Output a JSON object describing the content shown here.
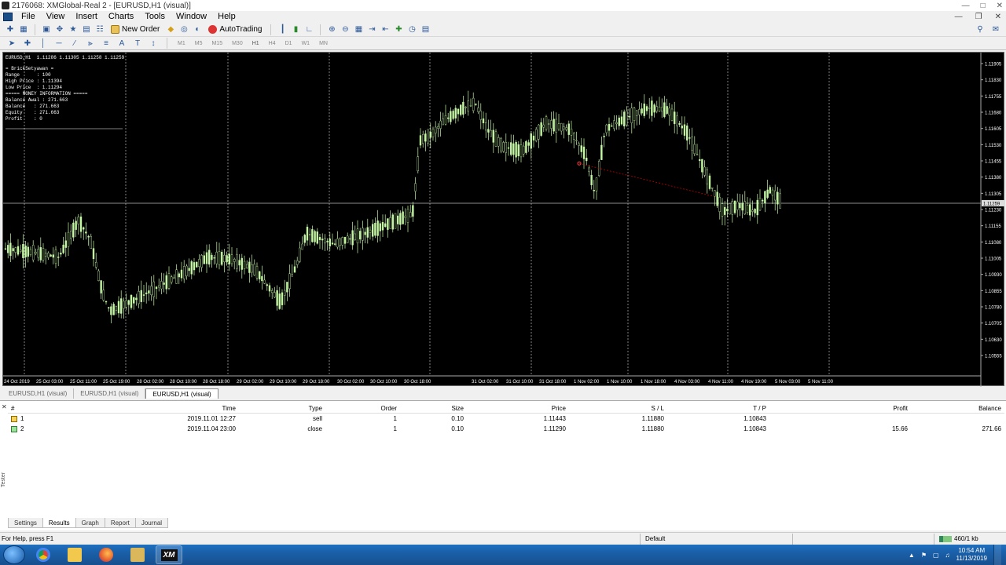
{
  "window": {
    "title": "2176068: XMGlobal-Real 2 - [EURUSD,H1 (visual)]"
  },
  "menu": {
    "items": [
      "File",
      "View",
      "Insert",
      "Charts",
      "Tools",
      "Window",
      "Help"
    ]
  },
  "toolbar": {
    "new_order_label": "New Order",
    "autotrading_label": "AutoTrading"
  },
  "toolbar2": {
    "timeframes": [
      "M1",
      "M5",
      "M15",
      "M30",
      "H1",
      "H4",
      "D1",
      "W1",
      "MN"
    ]
  },
  "chart": {
    "info_header": "EURUSD,H1  1.11286 1.11305 1.11258 1.11259",
    "info_lines": [
      "= BrickSetyawan =",
      "Range      : 100",
      "High Price : 1.11394",
      "Low Price  : 1.11294",
      "===== MONEY INFORMATION =====",
      "Balance Awal : 271.663",
      "Balance   : 271.663",
      "Equity    : 271.663",
      "Profit    : 0"
    ],
    "price_labels": [
      "1.11905",
      "1.11830",
      "1.11755",
      "1.11680",
      "1.11605",
      "1.11530",
      "1.11455",
      "1.11380",
      "1.11305",
      "1.11230",
      "1.11155",
      "1.11080",
      "1.11005",
      "1.10930",
      "1.10855",
      "1.10780",
      "1.10705",
      "1.10630",
      "1.10555"
    ],
    "current_price_label": "1.11259",
    "time_labels": [
      "24 Oct 2019",
      "25 Oct 03:00",
      "25 Oct 11:00",
      "25 Oct 19:00",
      "28 Oct 02:00",
      "28 Oct 10:00",
      "28 Oct 18:00",
      "29 Oct 02:00",
      "29 Oct 10:00",
      "29 Oct 18:00",
      "30 Oct 02:00",
      "30 Oct 10:00",
      "30 Oct 18:00",
      "31 Oct 02:00",
      "31 Oct 10:00",
      "31 Oct 18:00",
      "1 Nov 02:00",
      "1 Nov 10:00",
      "1 Nov 18:00",
      "4 Nov 03:00",
      "4 Nov 11:00",
      "4 Nov 19:00",
      "5 Nov 03:00",
      "5 Nov 11:00"
    ],
    "colors": {
      "background": "#000000",
      "candles": "#c6f7a6",
      "labels": "#2ec4c4",
      "grid": "#ffffff",
      "trade_line": "#c00000"
    }
  },
  "chart_tabs": [
    "EURUSD,H1 (visual)",
    "EURUSD,H1 (visual)",
    "EURUSD,H1 (visual)"
  ],
  "terminal": {
    "side_label": "Tester",
    "columns": [
      "#",
      "Time",
      "Type",
      "Order",
      "Size",
      "Price",
      "S / L",
      "T / P",
      "Profit",
      "Balance"
    ],
    "rows": [
      {
        "num": "1",
        "time": "2019.11.01 12:27",
        "type": "sell",
        "order": "1",
        "size": "0.10",
        "price": "1.11443",
        "sl": "1.11880",
        "tp": "1.10843",
        "profit": "",
        "balance": ""
      },
      {
        "num": "2",
        "time": "2019.11.04 23:00",
        "type": "close",
        "order": "1",
        "size": "0.10",
        "price": "1.11290",
        "sl": "1.11880",
        "tp": "1.10843",
        "profit": "15.66",
        "balance": "271.66"
      }
    ],
    "tabs": [
      "Settings",
      "Results",
      "Graph",
      "Report",
      "Journal"
    ]
  },
  "statusbar": {
    "help": "For Help, press F1",
    "profile": "Default",
    "traffic": "460/1 kb"
  },
  "taskbar": {
    "clock_time": "10:54 AM",
    "clock_date": "11/13/2019"
  }
}
